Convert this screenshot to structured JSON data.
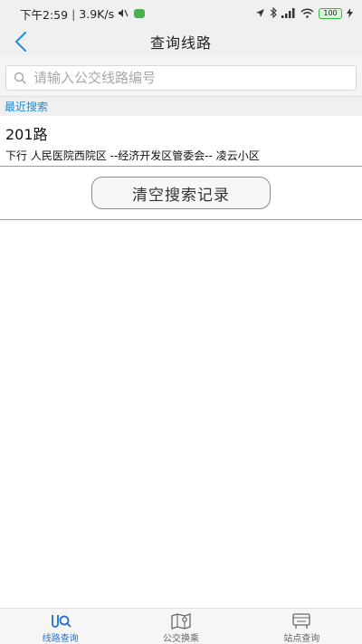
{
  "status_bar": {
    "time": "下午2:59",
    "separator": "|",
    "speed": "3.9K/s",
    "battery": "100"
  },
  "header": {
    "title": "查询线路"
  },
  "search": {
    "placeholder": "请输入公交线路编号",
    "value": ""
  },
  "recent": {
    "label": "最近搜索",
    "items": [
      {
        "route": "201路",
        "detail": "下行 人民医院西院区 --经济开发区管委会-- 凌云小区"
      }
    ],
    "clear_label": "清空搜索记录"
  },
  "tabs": [
    {
      "label": "线路查询",
      "icon": "route-search-icon",
      "active": true
    },
    {
      "label": "公交换乘",
      "icon": "transfer-map-icon",
      "active": false
    },
    {
      "label": "站点查询",
      "icon": "bus-stop-icon",
      "active": false
    }
  ],
  "colors": {
    "accent": "#1e6fd9",
    "section_label": "#1e8ad6",
    "back_arrow": "#2f8fe0"
  }
}
